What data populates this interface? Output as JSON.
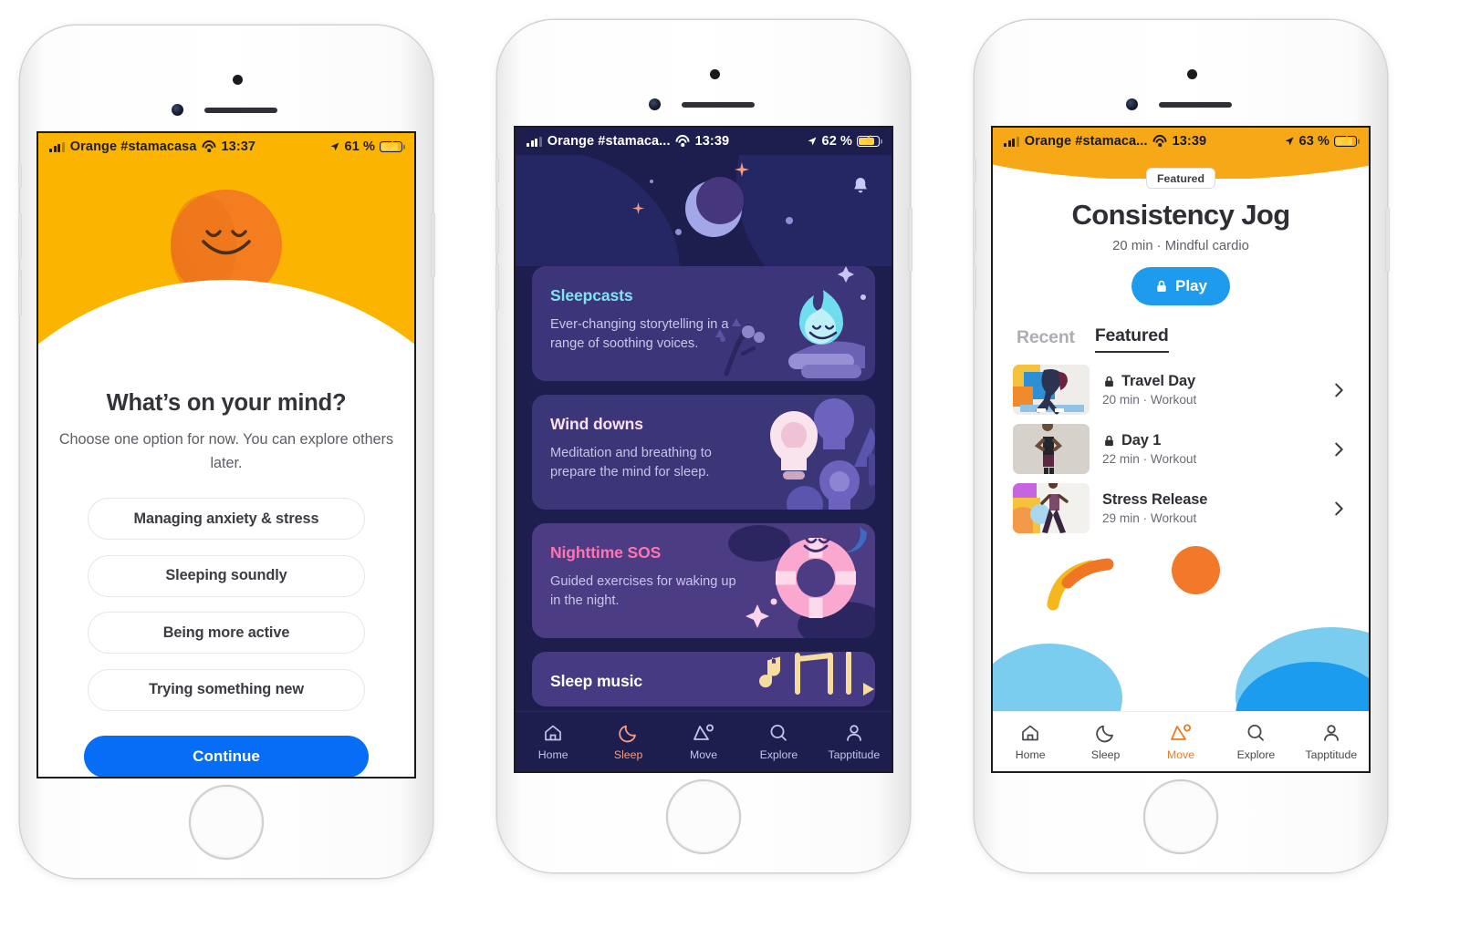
{
  "phone1": {
    "status": {
      "carrier": "Orange #stamacasa",
      "time": "13:37",
      "battery": "61 %",
      "signal_icon": "cellular-bars-icon",
      "wifi_icon": "wifi-icon",
      "location_icon": "location-arrow-icon",
      "battery_icon": "battery-charging-icon"
    },
    "hero_icon": "headspace-smiling-sun-icon",
    "title": "What’s on your mind?",
    "subtitle": "Choose one option for now. You can explore others later.",
    "options": [
      {
        "label": "Managing anxiety & stress"
      },
      {
        "label": "Sleeping soundly"
      },
      {
        "label": "Being more active"
      },
      {
        "label": "Trying something new"
      }
    ],
    "continue_label": "Continue",
    "colors": {
      "hero": "#FBB400",
      "sun": "#F47D20",
      "cta": "#066DF7"
    }
  },
  "phone2": {
    "status": {
      "carrier": "Orange #stamaca...",
      "time": "13:39",
      "battery": "62 %",
      "signal_icon": "cellular-bars-icon",
      "wifi_icon": "wifi-icon",
      "location_icon": "location-arrow-icon",
      "battery_icon": "battery-charging-icon"
    },
    "header_icons": {
      "bell": "notification-bell-icon",
      "moon": "crescent-moon-icon",
      "stars": "sparkle-star-icon"
    },
    "cards": [
      {
        "title": "Sleepcasts",
        "desc": "Ever-changing storytelling in a range of soothing voices.",
        "art_icon": "campfire-flame-character-icon",
        "accent": "#7FE3F0"
      },
      {
        "title": "Wind downs",
        "desc": "Meditation and breathing to prepare the mind for sleep.",
        "art_icon": "lightbulb-icon",
        "accent": "#FBE0EC"
      },
      {
        "title": "Nighttime SOS",
        "desc": "Guided exercises for waking up in the night.",
        "art_icon": "life-ring-character-icon",
        "accent": "#FF74B0"
      },
      {
        "title": "Sleep music",
        "desc": "",
        "art_icon": "music-notes-icon",
        "accent": "#FFFFFF"
      }
    ],
    "tabs": [
      {
        "label": "Home",
        "icon": "home-icon",
        "active": false
      },
      {
        "label": "Sleep",
        "icon": "moon-icon",
        "active": true
      },
      {
        "label": "Move",
        "icon": "move-mountain-icon",
        "active": false
      },
      {
        "label": "Explore",
        "icon": "search-icon",
        "active": false
      },
      {
        "label": "Tapptitude",
        "icon": "person-icon",
        "active": false
      }
    ],
    "colors": {
      "bg": "#1D1E4E",
      "active_tab": "#F49C86"
    }
  },
  "phone3": {
    "status": {
      "carrier": "Orange #stamaca...",
      "time": "13:39",
      "battery": "63 %",
      "signal_icon": "cellular-bars-icon",
      "wifi_icon": "wifi-icon",
      "location_icon": "location-arrow-icon",
      "battery_icon": "battery-charging-icon"
    },
    "badge": "Featured",
    "title": "Consistency Jog",
    "meta": "20 min · Mindful cardio",
    "play_label": "Play",
    "play_icon": "lock-icon",
    "segments": [
      {
        "label": "Recent",
        "active": false
      },
      {
        "label": "Featured",
        "active": true
      }
    ],
    "items": [
      {
        "title": "Travel Day",
        "meta": "20 min · Workout",
        "locked": true,
        "lock_icon": "lock-icon",
        "chevron_icon": "chevron-right-icon",
        "thumb": "person-stretching-thumbnail"
      },
      {
        "title": "Day 1",
        "meta": "22 min · Workout",
        "locked": true,
        "lock_icon": "lock-icon",
        "chevron_icon": "chevron-right-icon",
        "thumb": "person-boxing-thumbnail"
      },
      {
        "title": "Stress Release",
        "meta": "29 min · Workout",
        "locked": false,
        "lock_icon": "",
        "chevron_icon": "chevron-right-icon",
        "thumb": "person-lunging-thumbnail"
      }
    ],
    "tabs": [
      {
        "label": "Home",
        "icon": "home-icon",
        "active": false
      },
      {
        "label": "Sleep",
        "icon": "moon-icon",
        "active": false
      },
      {
        "label": "Move",
        "icon": "move-mountain-icon",
        "active": true
      },
      {
        "label": "Explore",
        "icon": "search-icon",
        "active": false
      },
      {
        "label": "Tapptitude",
        "icon": "person-icon",
        "active": false
      }
    ],
    "colors": {
      "play": "#1F9BEE",
      "active_tab": "#F07A22",
      "wave": "#F6A816"
    }
  }
}
